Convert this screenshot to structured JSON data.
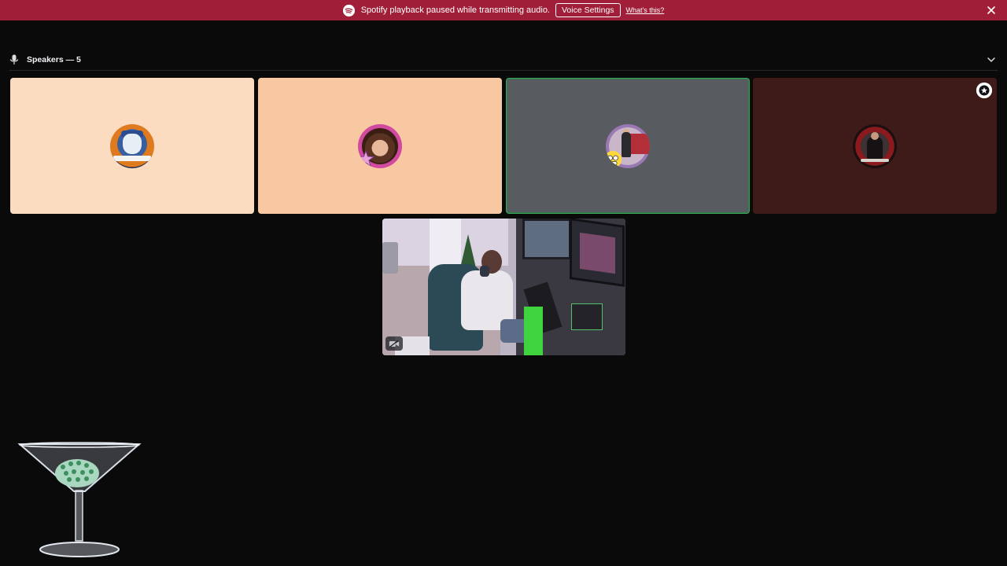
{
  "notice": {
    "icon": "spotify-icon",
    "message": "Spotify playback paused while transmitting audio.",
    "button_label": "Voice Settings",
    "link_label": "What's this?",
    "close_icon": "close-icon",
    "background": "#a01e37"
  },
  "speakers": {
    "icon": "microphone-icon",
    "title": "Speakers — 5",
    "collapse_icon": "chevron-down-icon",
    "tiles": [
      {
        "name": "speaker-tile-1",
        "avatar": "wolf-logo-avatar",
        "avatar_text": "SAVAGEDOGVR",
        "background": "#fbdcc0",
        "speaking": false
      },
      {
        "name": "speaker-tile-2",
        "avatar": "woman-portrait-avatar",
        "background": "#f8c8a3",
        "speaking": false
      },
      {
        "name": "speaker-tile-3",
        "avatar": "man-with-truck-avatar",
        "background": "#585b5f",
        "speaking": true,
        "speaking_color": "#3ba55d"
      },
      {
        "name": "speaker-tile-4",
        "avatar": "man-reading-avatar",
        "background": "#3e1b19",
        "speaking": false,
        "badge_icon": "stage-moderator-icon"
      }
    ],
    "video_tile": {
      "name": "video-tile-streamer",
      "content": "webcam feed of person at desk with monitors",
      "overlay_icon": "camera-icon"
    }
  },
  "decoration": {
    "icon": "martini-glass-icon"
  },
  "colors": {
    "page_background": "#0a0a0b",
    "divider": "#26282c",
    "text": "#f2f3f5"
  }
}
